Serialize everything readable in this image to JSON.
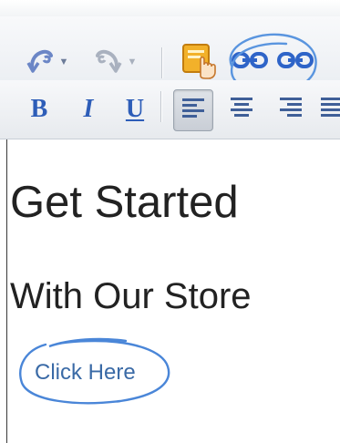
{
  "toolbar": {
    "undo_icon": "undo-icon",
    "redo_icon": "redo-icon",
    "insert_link_icon": "insert-link-hand-icon",
    "link_icon": "link-icon",
    "unlink_icon": "unlink-icon"
  },
  "format": {
    "bold_label": "B",
    "italic_label": "I",
    "underline_label": "U",
    "align_left_active": true
  },
  "content": {
    "heading": "Get Started",
    "subheading": "With Our Store",
    "link_text": "Click Here"
  },
  "colors": {
    "accent": "#2d5db8",
    "annotation": "#4a86d8",
    "text": "#222222",
    "link": "#3a6aa6"
  }
}
